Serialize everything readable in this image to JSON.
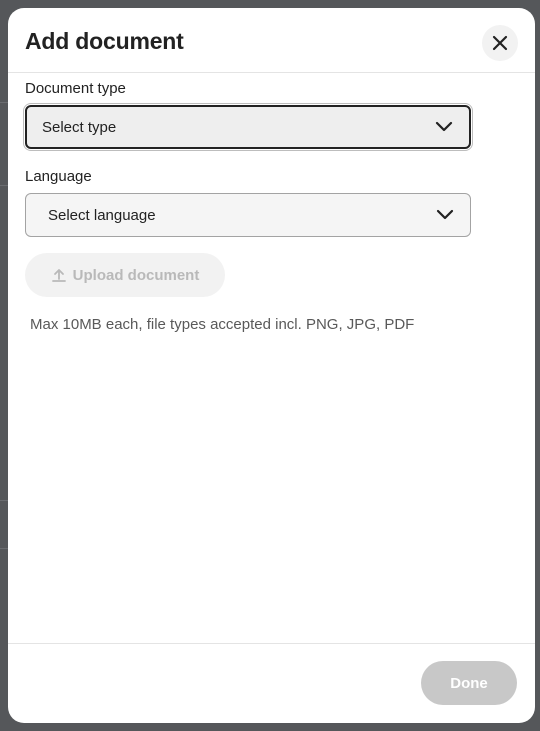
{
  "modal": {
    "title": "Add document",
    "close_icon": "close-icon"
  },
  "document_type": {
    "label": "Document type",
    "value": "Select type"
  },
  "language": {
    "label": "Language",
    "value": "Select language"
  },
  "upload": {
    "label": "Upload document",
    "icon": "upload-icon",
    "hint": "Max 10MB each, file types accepted incl. PNG, JPG, PDF"
  },
  "footer": {
    "done_label": "Done"
  },
  "colors": {
    "disabled_button": "#c8c8c8",
    "overlay": "#55575a"
  }
}
